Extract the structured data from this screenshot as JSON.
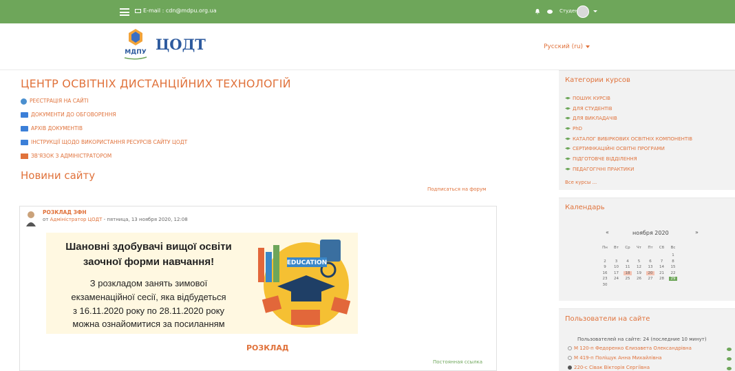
{
  "topbar": {
    "email": "E-mail : cdn@mdpu.org.ua",
    "user_label": "Студент"
  },
  "header": {
    "logo_text": "ЦОДТ",
    "logo_caption": "МДПУ",
    "language": "Русский (ru)"
  },
  "main": {
    "title": "ЦЕНТР ОСВІТНІХ ДИСТАНЦІЙНИХ ТЕХНОЛОГІЙ",
    "links": [
      {
        "label": "РЕЄСТРАЦІЯ НА САЙТІ",
        "icon": "globe-icon"
      },
      {
        "label": "ДОКУМЕНТИ ДО ОБГОВОРЕННЯ",
        "icon": "folder-icon"
      },
      {
        "label": "АРХІВ ДОКУМЕНТІВ",
        "icon": "folder-icon"
      },
      {
        "label": "ІНСТРУКЦІЇ ЩОДО ВИКОРИСТАННЯ РЕСУРСІВ САЙТУ ЦОДТ",
        "icon": "folder-icon"
      },
      {
        "label": "ЗВ'ЯЗОК З АДМІНІСТРАТОРОМ",
        "icon": "megaphone-icon"
      }
    ],
    "news_heading": "Новини сайту",
    "subscribe": "Подписаться на форум",
    "post": {
      "title": "РОЗКЛАД ЗФН",
      "meta_prefix": "от",
      "author": "Адміністратор ЦОДТ",
      "meta_date": "- пятница, 13 ноября 2020, 12:08",
      "banner_lines": [
        "Шановні здобувачі вищої освіти",
        "заочної форми навчання!",
        "З розкладом занять зимової",
        "екзаменаційної сесії, яка відбудеться",
        "з 16.11.2020 року по 28.11.2020 року",
        "можна ознайомитися за посиланням"
      ],
      "banner_badge": "EDUCATION",
      "link_label": "РОЗКЛАД",
      "permalink": "Постоянная ссылка"
    }
  },
  "categories": {
    "title": "Категории курсов",
    "items": [
      "ПОШУК КУРСІВ",
      "ДЛЯ СТУДЕНТІВ",
      "ДЛЯ ВИКЛАДАЧІВ",
      "PhD",
      "КАТАЛОГ ВИБІРКОВИХ ОСВІТНІХ КОМПОНЕНТІВ",
      "СЕРТИФІКАЦІЙНІ ОСВІТНІ ПРОГРАМИ",
      "ПІДГОТОВЧЕ ВІДДІЛЕННЯ",
      "ПЕДАГОГІЧНІ ПРАКТИКИ"
    ],
    "all": "Все курсы ..."
  },
  "calendar": {
    "title": "Календарь",
    "prev": "«",
    "next": "»",
    "month": "ноября 2020",
    "weekdays": [
      "Пн",
      "Вт",
      "Ср",
      "Чт",
      "Пт",
      "Сб",
      "Вс"
    ],
    "weeks": [
      [
        "",
        "",
        "",
        "",
        "",
        "",
        "1"
      ],
      [
        "2",
        "3",
        "4",
        "5",
        "6",
        "7",
        "8"
      ],
      [
        "9",
        "10",
        "11",
        "12",
        "13",
        "14",
        "15"
      ],
      [
        "16",
        "17",
        "18",
        "19",
        "20",
        "21",
        "22"
      ],
      [
        "23",
        "24",
        "25",
        "26",
        "27",
        "28",
        "29"
      ],
      [
        "30",
        "",
        "",
        "",
        "",
        "",
        ""
      ]
    ],
    "highlighted": [
      "18",
      "20"
    ],
    "today": "29"
  },
  "online": {
    "title": "Пользователи на сайте",
    "summary": "Пользователей на сайте: 24 (последние 10 минут)",
    "users": [
      "М 120-п Федоренко Єлизавета Олександрівна",
      "М 419-п Поліщук Анна Михайлівна",
      "220-с Сівак Вікторія Сергіївна"
    ]
  }
}
